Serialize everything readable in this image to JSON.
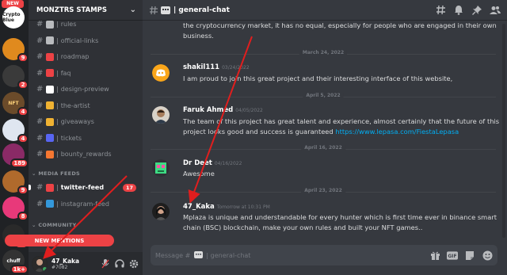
{
  "server_rail": {
    "new_label": "NEW",
    "servers": [
      {
        "name": "crypto-blue",
        "text": "Crypto Blue",
        "color": "#ffffff",
        "textColor": "#1a1a1a",
        "badge": ""
      },
      {
        "name": "orange-server",
        "text": "",
        "color": "#e08a1e",
        "textColor": "#fff",
        "badge": "9"
      },
      {
        "name": "black-server",
        "text": "",
        "color": "#3a3a3a",
        "textColor": "#fff",
        "badge": "2"
      },
      {
        "name": "nft-server",
        "text": "NFT",
        "color": "#6b4b2a",
        "textColor": "#ffd27a",
        "badge": "4"
      },
      {
        "name": "astronaut-server",
        "text": "",
        "color": "#dfe6f0",
        "textColor": "#333",
        "badge": "4"
      },
      {
        "name": "pink-server",
        "text": "",
        "color": "#8a2a66",
        "textColor": "#fff",
        "badge": "189"
      },
      {
        "name": "cat-server",
        "text": "",
        "color": "#b06a2c",
        "textColor": "#fff",
        "badge": "9"
      },
      {
        "name": "pixel-server",
        "text": "",
        "color": "#e8397a",
        "textColor": "#fff",
        "badge": "8"
      },
      {
        "name": "gold-server",
        "text": "",
        "color": "#2a2a2a",
        "textColor": "#ffcc00",
        "badge": "44"
      },
      {
        "name": "chuff-server",
        "text": "chuff",
        "color": "#333333",
        "textColor": "#fff",
        "badge": "1k+"
      },
      {
        "name": "pink-avatar-server",
        "text": "",
        "color": "#e06aa6",
        "textColor": "#fff",
        "badge": "62"
      }
    ]
  },
  "sidebar": {
    "server_name": "MONZTRS STAMPS",
    "channels": [
      {
        "label": "rules",
        "icon": "☑",
        "iconColor": "#b9bbbe",
        "unread": false,
        "pill": ""
      },
      {
        "label": "official-links",
        "icon": "🔗",
        "iconColor": "#b9bbbe",
        "unread": false,
        "pill": ""
      },
      {
        "label": "roadmap",
        "icon": "📍",
        "iconColor": "#ed4245",
        "unread": false,
        "pill": ""
      },
      {
        "label": "faq",
        "icon": "❗",
        "iconColor": "#ed4245",
        "unread": false,
        "pill": ""
      },
      {
        "label": "design-preview",
        "icon": "👀",
        "iconColor": "#fff",
        "unread": false,
        "pill": ""
      },
      {
        "label": "the-artist",
        "icon": "🎨",
        "iconColor": "#f0b232",
        "unread": false,
        "pill": ""
      },
      {
        "label": "giveaways",
        "icon": "🎉",
        "iconColor": "#f0b232",
        "unread": false,
        "pill": ""
      },
      {
        "label": "tickets",
        "icon": "🎫",
        "iconColor": "#5865f2",
        "unread": false,
        "pill": ""
      },
      {
        "label": "bounty_rewards",
        "icon": "🔥",
        "iconColor": "#f57731",
        "unread": false,
        "pill": ""
      }
    ],
    "media_category": "MEDIA FEEDS",
    "media_channels": [
      {
        "label": "twitter-feed",
        "icon": "🐦",
        "iconColor": "#ed4245",
        "unread": true,
        "pill": "17"
      },
      {
        "label": "instagram-feed",
        "icon": "📷",
        "iconColor": "#3498db",
        "unread": false,
        "pill": ""
      }
    ],
    "community_category": "COMMUNITY",
    "new_mentions": "NEW MENTIONS"
  },
  "user_panel": {
    "username": "47_Kaka",
    "tag": "#7082"
  },
  "chat": {
    "channel_title": "| general-chat",
    "top_text": "the cryptocurrency market, it has no equal, especially for people who are engaged in their own business.",
    "dividers": [
      "March 24, 2022",
      "April 5, 2022",
      "April 16, 2022",
      "April 23, 2022"
    ],
    "messages": [
      {
        "author": "shakil111",
        "time": "03/24/2022",
        "text": "I am proud to join this great project and their interesting interface of this website,",
        "link": ""
      },
      {
        "author": "Faruk Ahmed",
        "time": "04/05/2022",
        "text": "The team of this project has great talent and experience, almost certainly that the future of this project looks good and success is guaranteed ",
        "link": "https://www.lepasa.com/FiestaLepasa"
      },
      {
        "author": "Dr Deet",
        "time": "04/16/2022",
        "text": "Awesome",
        "link": ""
      },
      {
        "author": "47_Kaka",
        "time": "Tomorrow at 10:31 PM",
        "text": "Mplaza is unique and understandable for every hunter which is first time ever in binance smart chain (BSC) blockchain, make your own rules and built your NFT games..",
        "link": ""
      }
    ],
    "composer_placeholder": "Message #",
    "composer_channel": "| general-chat"
  },
  "colors": {
    "accent_red": "#ed4245",
    "link": "#00aff4",
    "online": "#3ba55d"
  }
}
